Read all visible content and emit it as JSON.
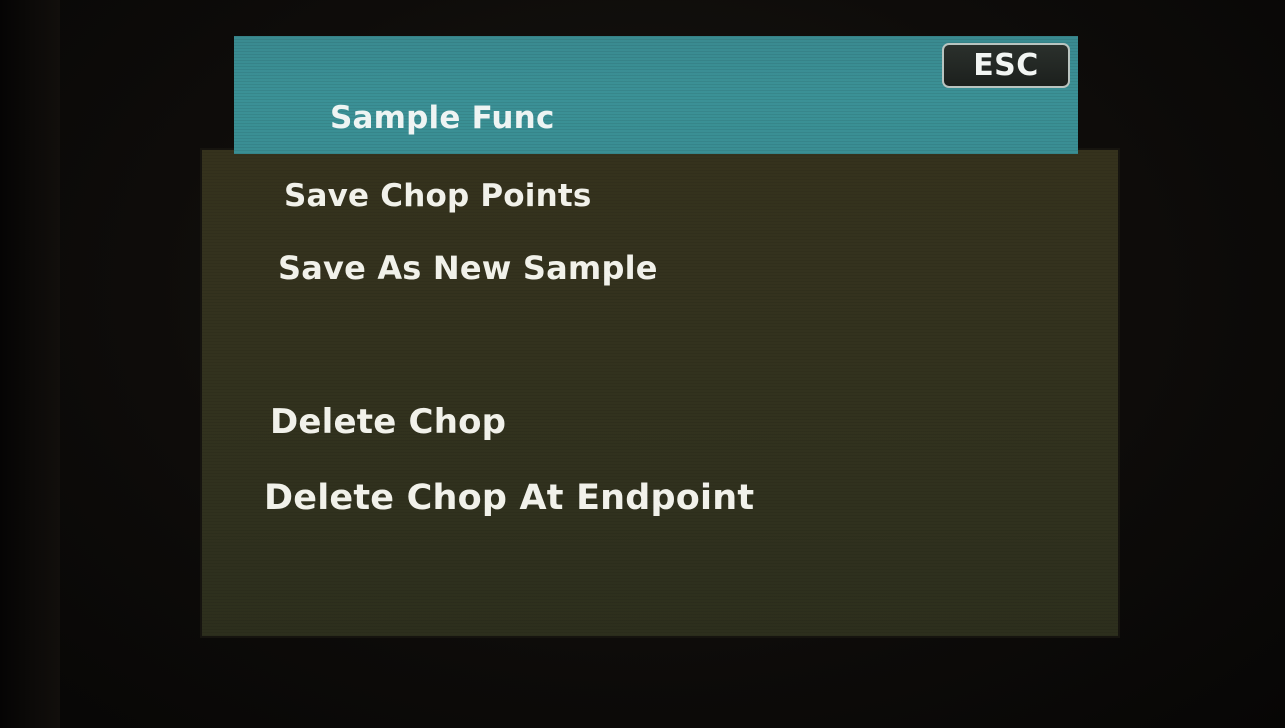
{
  "header": {
    "title": "Sample Func",
    "esc_label": "ESC"
  },
  "menu": {
    "items": [
      {
        "label": "Save Chop Points"
      },
      {
        "label": "Save As New Sample"
      },
      {
        "label": "Delete Chop"
      },
      {
        "label": "Delete Chop At Endpoint"
      }
    ]
  },
  "colors": {
    "header_bar": "#3b9196",
    "screen_background": "#33321e",
    "text": "#f1f1ea"
  }
}
